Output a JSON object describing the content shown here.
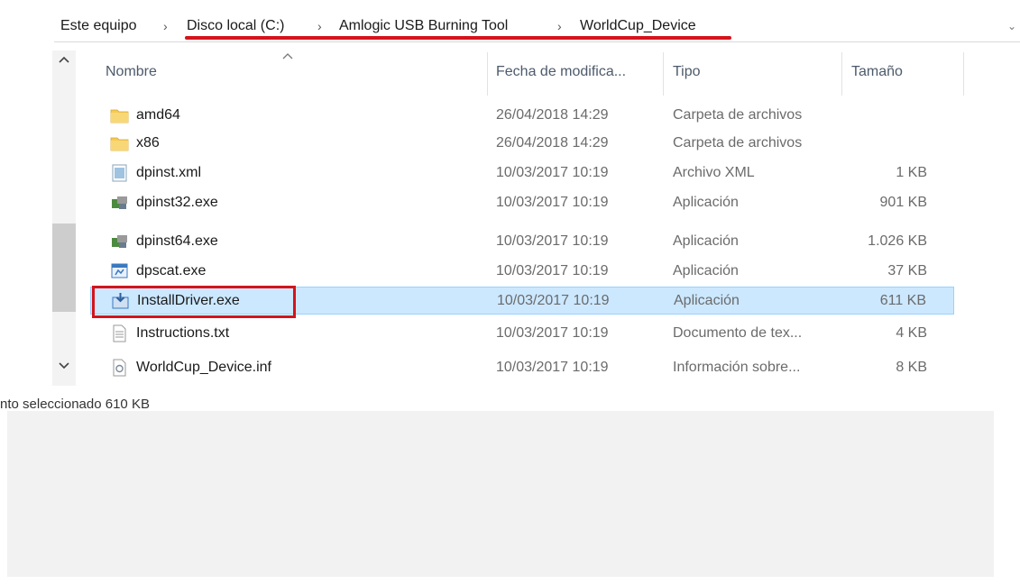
{
  "breadcrumb": {
    "items": [
      "Este equipo",
      "Disco local (C:)",
      "Amlogic USB Burning Tool",
      "WorldCup_Device"
    ],
    "separator": "›",
    "right_chevron": "⌄"
  },
  "columns": {
    "name": "Nombre",
    "date": "Fecha de modifica...",
    "type": "Tipo",
    "size": "Tamaño"
  },
  "files": [
    {
      "name": "amd64",
      "date": "26/04/2018 14:29",
      "type": "Carpeta de archivos",
      "size": "",
      "icon": "folder-icon"
    },
    {
      "name": "x86",
      "date": "26/04/2018 14:29",
      "type": "Carpeta de archivos",
      "size": "",
      "icon": "folder-icon"
    },
    {
      "name": "dpinst.xml",
      "date": "10/03/2017 10:19",
      "type": "Archivo XML",
      "size": "1 KB",
      "icon": "xml-file-icon"
    },
    {
      "name": "dpinst32.exe",
      "date": "10/03/2017 10:19",
      "type": "Aplicación",
      "size": "901 KB",
      "icon": "installer-exe-icon"
    },
    {
      "name": "dpinst64.exe",
      "date": "10/03/2017 10:19",
      "type": "Aplicación",
      "size": "1.026 KB",
      "icon": "installer-exe-icon"
    },
    {
      "name": "dpscat.exe",
      "date": "10/03/2017 10:19",
      "type": "Aplicación",
      "size": "37 KB",
      "icon": "app-window-icon"
    },
    {
      "name": "InstallDriver.exe",
      "date": "10/03/2017 10:19",
      "type": "Aplicación",
      "size": "611 KB",
      "icon": "download-exe-icon",
      "selected": true
    },
    {
      "name": "Instructions.txt",
      "date": "10/03/2017 10:19",
      "type": "Documento de tex...",
      "size": "4 KB",
      "icon": "text-file-icon"
    },
    {
      "name": "WorldCup_Device.inf",
      "date": "10/03/2017 10:19",
      "type": "Información sobre...",
      "size": "8 KB",
      "icon": "inf-file-icon"
    }
  ],
  "status": {
    "text": "nto seleccionado  610 KB"
  },
  "colors": {
    "highlight": "#d4141b",
    "selection_bg": "#cce8ff",
    "selection_border": "#99d1ff",
    "folder": "#f5c955"
  }
}
